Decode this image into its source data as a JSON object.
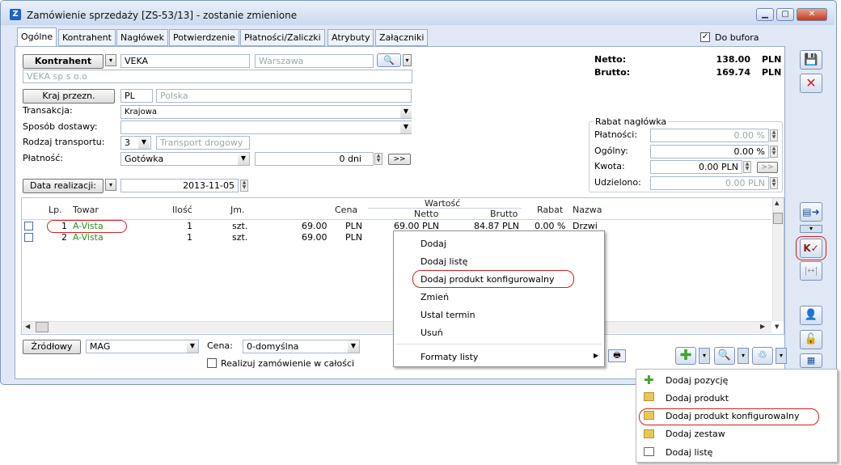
{
  "window": {
    "title": "Zamówienie sprzedaży [ZS-53/13] - zostanie zmienione",
    "app_icon": "Z"
  },
  "tabs": [
    "Ogólne",
    "Kontrahent",
    "Nagłówek",
    "Potwierdzenie",
    "Płatności/Zaliczki",
    "Atrybuty",
    "Załączniki"
  ],
  "do_bufora": {
    "label": "Do bufora",
    "checked": true
  },
  "kontrahent": {
    "button": "Kontrahent",
    "code": "VEKA",
    "city": "Warszawa",
    "name": "VEKA sp s o.o"
  },
  "kraj": {
    "button": "Kraj przezn.",
    "code": "PL",
    "name": "Polska"
  },
  "transakcja": {
    "label": "Transakcja:",
    "value": "Krajowa"
  },
  "sposob_dostawy": {
    "label": "Sposób dostawy:",
    "value": ""
  },
  "rodzaj_transportu": {
    "label": "Rodzaj transportu:",
    "code": "3",
    "name": "Transport drogowy"
  },
  "platnosc": {
    "label": "Płatność:",
    "value": "Gotówka",
    "days": "0 dni",
    "more": ">>"
  },
  "data_realizacji": {
    "button": "Data realizacji:",
    "value": "2013-11-05"
  },
  "totals": {
    "netto_label": "Netto:",
    "netto": "138.00",
    "netto_cur": "PLN",
    "brutto_label": "Brutto:",
    "brutto": "169.74",
    "brutto_cur": "PLN"
  },
  "rabat": {
    "title": "Rabat nagłówka",
    "platnosci_label": "Płatności:",
    "platnosci": "0.00 %",
    "ogolny_label": "Ogólny:",
    "ogolny": "0.00 %",
    "kwota_label": "Kwota:",
    "kwota": "0.00 PLN",
    "kwota_more": ">>",
    "udzielono_label": "Udzielono:",
    "udzielono": "0.00 PLN"
  },
  "grid": {
    "headers": {
      "lp": "Lp.",
      "towar": "Towar",
      "ilosc": "Ilość",
      "jm": "Jm.",
      "cena": "Cena",
      "wartosc": "Wartość",
      "netto": "Netto",
      "brutto": "Brutto",
      "rabat": "Rabat",
      "nazwa": "Nazwa"
    },
    "rows": [
      {
        "lp": "1",
        "towar": "A-Vista",
        "ilosc": "1",
        "jm": "szt.",
        "cena": "69.00",
        "cur": "PLN",
        "netto": "69.00 PLN",
        "brutto": "84.87 PLN",
        "rabat": "0.00 %",
        "nazwa": "Drzwi"
      },
      {
        "lp": "2",
        "towar": "A-Vista",
        "ilosc": "1",
        "jm": "szt.",
        "cena": "69.00",
        "cur": "PLN",
        "netto": "",
        "brutto": "",
        "rabat": "",
        "nazwa": ""
      }
    ]
  },
  "bottom": {
    "zrodlowy": "Źródłowy",
    "mag": "MAG",
    "cena_label": "Cena:",
    "cena": "0-domyślna",
    "realizuj": "Realizuj zamówienie w całości"
  },
  "context_menu": [
    "Dodaj",
    "Dodaj listę",
    "Dodaj produkt konfigurowalny",
    "Zmień",
    "Ustal termin",
    "Usuń",
    "Formaty listy"
  ],
  "dropdown_menu": [
    "Dodaj pozycję",
    "Dodaj produkt",
    "Dodaj produkt konfigurowalny",
    "Dodaj zestaw",
    "Dodaj listę"
  ],
  "colors": {
    "accent_red": "#d21f1f",
    "link_green": "#2e8b1e",
    "plus_green": "#3fa52b"
  }
}
